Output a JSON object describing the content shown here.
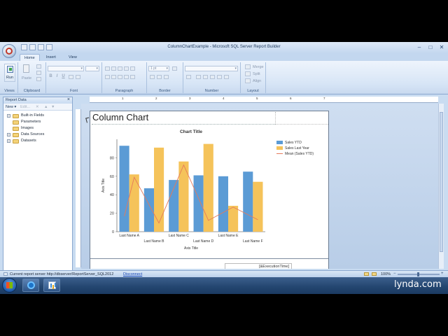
{
  "window": {
    "title": "ColumnChartExample - Microsoft SQL Server Report Builder"
  },
  "ribbon": {
    "tabs": [
      {
        "label": "Home",
        "active": true
      },
      {
        "label": "Insert",
        "active": false
      },
      {
        "label": "View",
        "active": false
      }
    ],
    "groups": {
      "views": "Views",
      "clipboard": "Clipboard",
      "font": "Font",
      "paragraph": "Paragraph",
      "border": "Border",
      "number": "Number",
      "layout": "Layout"
    },
    "run_label": "Run",
    "paste_label": "Paste",
    "border_width": "1 pt",
    "layout_items": [
      "Merge",
      "Split",
      "Align"
    ]
  },
  "report_data": {
    "title": "Report Data",
    "new_label": "New",
    "edit_label": "Edit...",
    "items": [
      "Built-in Fields",
      "Parameters",
      "Images",
      "Data Sources",
      "Datasets"
    ]
  },
  "ruler": {
    "marks": [
      "1",
      "2",
      "3",
      "4",
      "5",
      "6",
      "7"
    ]
  },
  "report": {
    "title": "Column Chart",
    "exec_time": "[&ExecutionTime]"
  },
  "chart_data": {
    "type": "bar",
    "title": "Chart Title",
    "xlabel": "Axis Title",
    "ylabel": "Axis Title",
    "categories": [
      "Last Name A",
      "Last Name B",
      "Last Name C",
      "Last Name D",
      "Last Name E",
      "Last Name F"
    ],
    "series": [
      {
        "name": "Sales YTD",
        "type": "bar",
        "color": "#5b9bd5",
        "values": [
          93,
          47,
          56,
          61,
          60,
          65
        ]
      },
      {
        "name": "Sales Last Year",
        "type": "bar",
        "color": "#f5c35a",
        "values": [
          62,
          91,
          76,
          95,
          28,
          54
        ]
      },
      {
        "name": "Mean (Sales YTD)",
        "type": "line",
        "color": "#e57a5a"
      }
    ],
    "ylim": [
      0,
      100
    ],
    "yticks": [
      0,
      20,
      40,
      60,
      80
    ],
    "legend": "right",
    "grid": false
  },
  "statusbar": {
    "server_text": "Current report server http://dbserver/ReportServer_SQL2012",
    "disconnect": "Disconnect",
    "zoom": "100%"
  },
  "branding": {
    "watermark": "lynda.com"
  }
}
